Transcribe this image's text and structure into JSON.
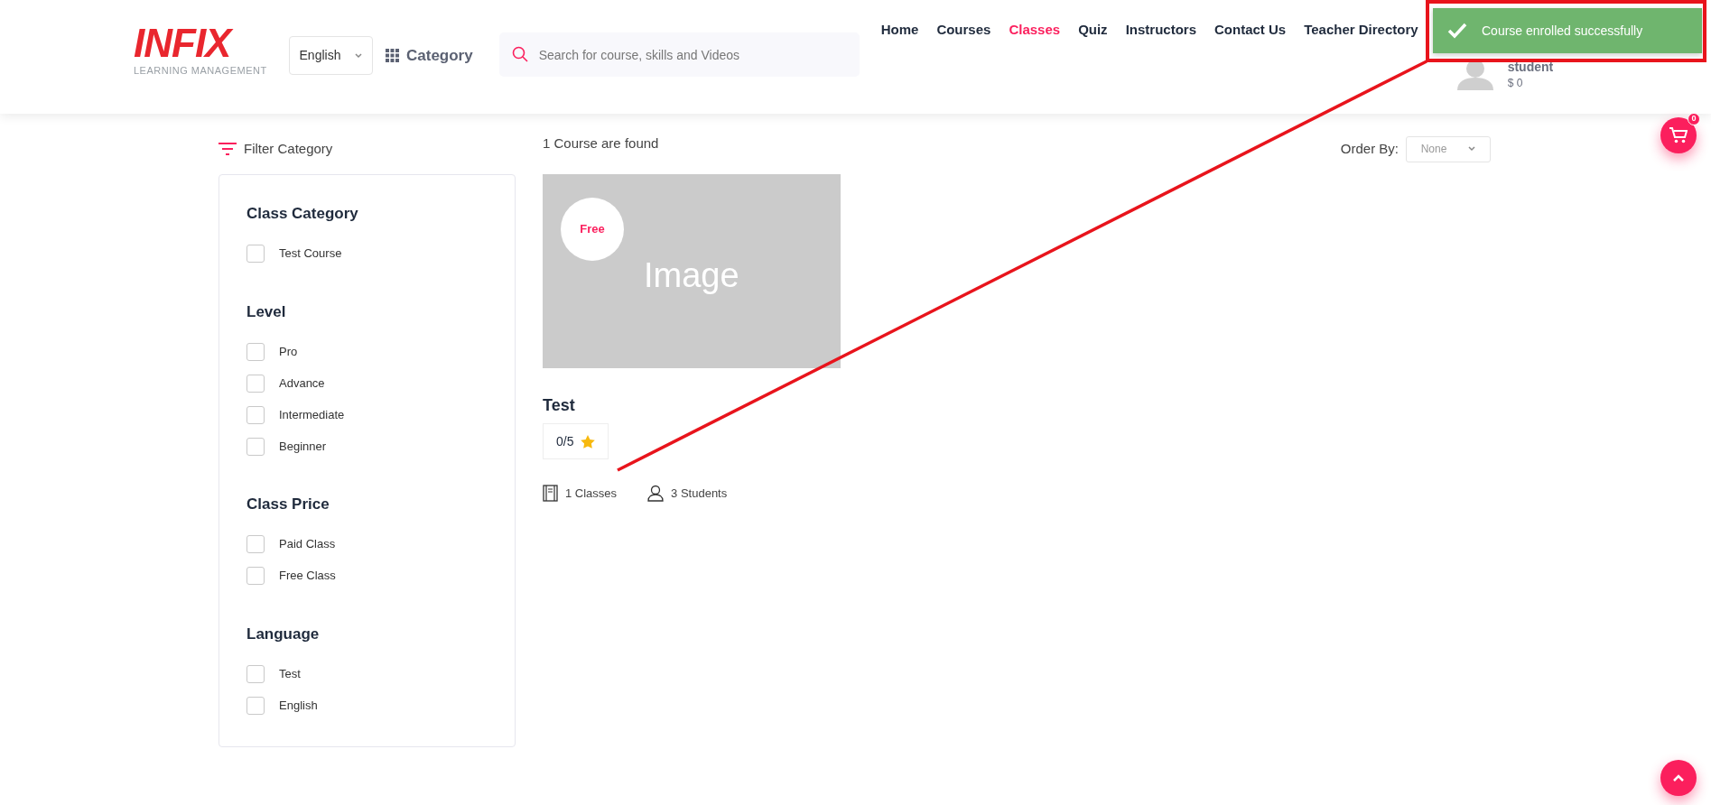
{
  "header": {
    "logo": {
      "title": "INFIX",
      "subtitle": "LEARNING MANAGEMENT"
    },
    "language": "English",
    "category_label": "Category",
    "search": {
      "placeholder": "Search for course, skills and Videos"
    },
    "nav": [
      {
        "label": "Home",
        "selected": false
      },
      {
        "label": "Courses",
        "selected": false
      },
      {
        "label": "Classes",
        "selected": true
      },
      {
        "label": "Quiz",
        "selected": false
      },
      {
        "label": "Instructors",
        "selected": false
      },
      {
        "label": "Contact Us",
        "selected": false
      },
      {
        "label": "Teacher Directory",
        "selected": false
      }
    ],
    "user": {
      "name": "student",
      "balance": "$ 0"
    }
  },
  "toast": {
    "message": "Course enrolled successfully"
  },
  "filter_title": "Filter Category",
  "filters": [
    {
      "title": "Class Category",
      "options": [
        {
          "label": "Test Course",
          "checked": false
        }
      ]
    },
    {
      "title": "Level",
      "options": [
        {
          "label": "Pro",
          "checked": false
        },
        {
          "label": "Advance",
          "checked": false
        },
        {
          "label": "Intermediate",
          "checked": false
        },
        {
          "label": "Beginner",
          "checked": false
        }
      ]
    },
    {
      "title": "Class Price",
      "options": [
        {
          "label": "Paid Class",
          "checked": false
        },
        {
          "label": "Free Class",
          "checked": false
        }
      ]
    },
    {
      "title": "Language",
      "options": [
        {
          "label": "Test",
          "checked": false
        },
        {
          "label": "English",
          "checked": false
        }
      ]
    }
  ],
  "results": {
    "count_text": "1 Course are found",
    "order_label": "Order By:",
    "order_value": "None"
  },
  "courses": [
    {
      "image_label": "Image",
      "price_badge": "Free",
      "title": "Test",
      "rating": "0/5",
      "classes": "1 Classes",
      "students": "3 Students"
    }
  ],
  "cart": {
    "count": "0"
  }
}
